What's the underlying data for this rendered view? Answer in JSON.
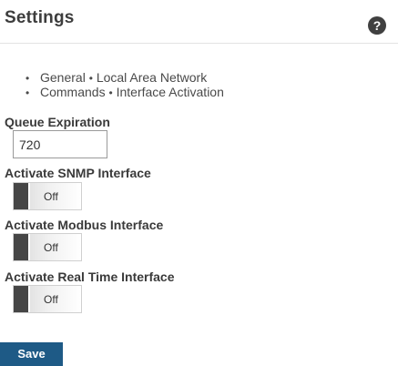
{
  "header": {
    "title": "Settings",
    "help_icon": "?"
  },
  "nav": {
    "bullet": "•",
    "row1": [
      "General",
      "Local Area Network"
    ],
    "row2": [
      "Commands",
      "Interface Activation"
    ]
  },
  "queue_expiration": {
    "label": "Queue Expiration",
    "value": "720"
  },
  "toggles": [
    {
      "label": "Activate SNMP Interface",
      "state": "Off"
    },
    {
      "label": "Activate Modbus Interface",
      "state": "Off"
    },
    {
      "label": "Activate Real Time Interface",
      "state": "Off"
    }
  ],
  "actions": {
    "save_label": "Save"
  },
  "colors": {
    "save_button": "#1e5a86",
    "toggle_handle": "#464646",
    "help_icon_bg": "#404040"
  }
}
